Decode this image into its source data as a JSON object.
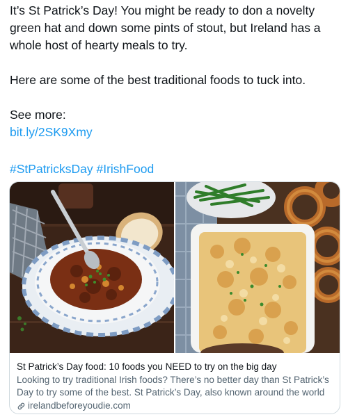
{
  "tweet": {
    "line1": "It’s St Patrick’s Day! You might be ready to don a novelty green hat and down some pints of stout, but Ireland has a whole host of hearty meals to try.",
    "line2": "Here are some of the best traditional foods to tuck into.",
    "see_more": "See more:",
    "link": "bit.ly/2SK9Xmy",
    "hashtags": [
      "#StPatricksDay",
      "#IrishFood"
    ]
  },
  "card": {
    "title": "St Patrick’s Day food: 10 foods you NEED to try on the big day",
    "description": "Looking to try traditional Irish foods? There’s no better day than St Patrick’s Day to try some of the best. St Patrick’s Day, also known around the world as...",
    "domain": "irelandbeforeyoudie.com",
    "domain_icon": "link-icon",
    "images": [
      "stew-bowl-photo",
      "shepherds-pie-photo"
    ]
  },
  "colors": {
    "link": "#1d9bf0",
    "text": "#0f1419",
    "muted": "#536471",
    "border": "#cfd9de"
  }
}
